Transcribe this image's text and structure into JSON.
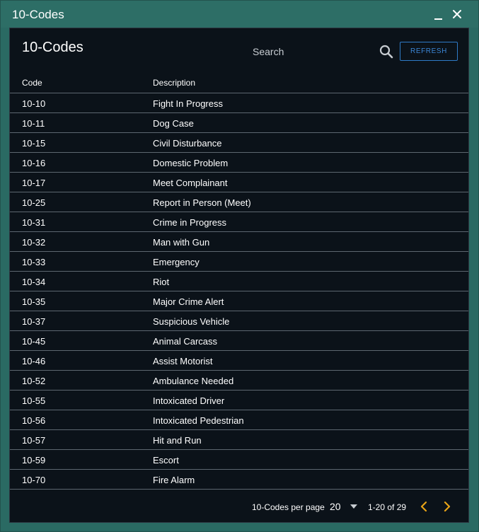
{
  "window": {
    "title": "10-Codes",
    "accent": "#2d6e66"
  },
  "panel": {
    "title": "10-Codes",
    "search_placeholder": "Search",
    "refresh_label": "REFRESH"
  },
  "table": {
    "columns": [
      "Code",
      "Description"
    ],
    "rows": [
      {
        "code": "10-10",
        "description": "Fight In Progress"
      },
      {
        "code": "10-11",
        "description": "Dog Case"
      },
      {
        "code": "10-15",
        "description": "Civil Disturbance"
      },
      {
        "code": "10-16",
        "description": "Domestic Problem"
      },
      {
        "code": "10-17",
        "description": "Meet Complainant"
      },
      {
        "code": "10-25",
        "description": "Report in Person (Meet)"
      },
      {
        "code": "10-31",
        "description": "Crime in Progress"
      },
      {
        "code": "10-32",
        "description": "Man with Gun"
      },
      {
        "code": "10-33",
        "description": "Emergency"
      },
      {
        "code": "10-34",
        "description": "Riot"
      },
      {
        "code": "10-35",
        "description": "Major Crime Alert"
      },
      {
        "code": "10-37",
        "description": "Suspicious Vehicle"
      },
      {
        "code": "10-45",
        "description": "Animal Carcass"
      },
      {
        "code": "10-46",
        "description": "Assist Motorist"
      },
      {
        "code": "10-52",
        "description": "Ambulance Needed"
      },
      {
        "code": "10-55",
        "description": "Intoxicated Driver"
      },
      {
        "code": "10-56",
        "description": "Intoxicated Pedestrian"
      },
      {
        "code": "10-57",
        "description": "Hit and Run"
      },
      {
        "code": "10-59",
        "description": "Escort"
      },
      {
        "code": "10-70",
        "description": "Fire Alarm"
      }
    ]
  },
  "pagination": {
    "per_page_label": "10-Codes per page",
    "page_size": "20",
    "range": "1-20 of 29",
    "arrow_color": "#e8a317"
  }
}
